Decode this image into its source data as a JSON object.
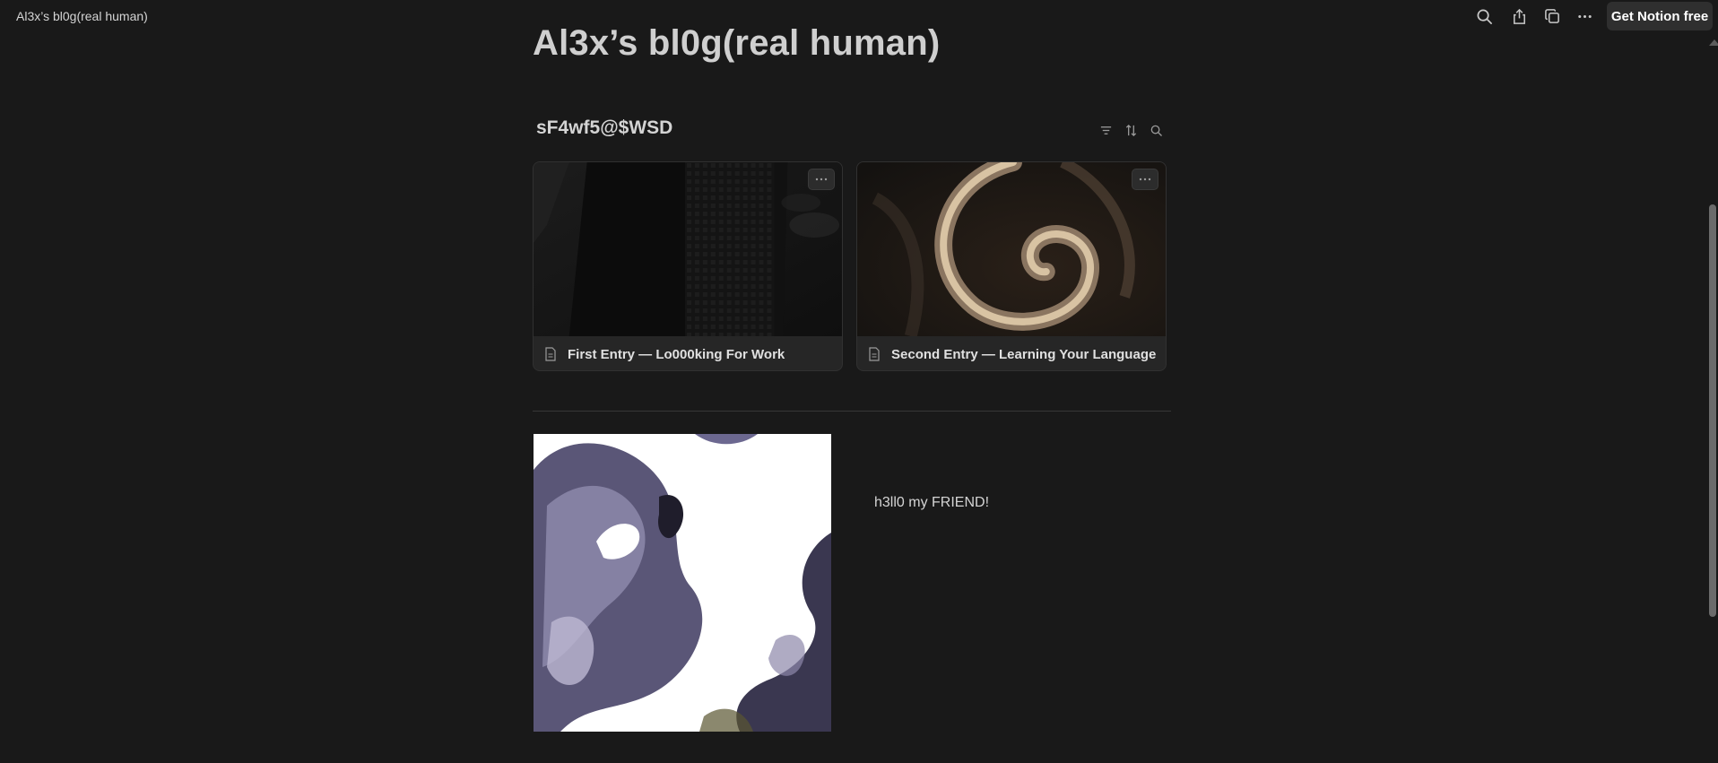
{
  "topbar": {
    "breadcrumb": "Al3x’s bl0g(real human)",
    "icons": [
      "search-icon",
      "share-icon",
      "duplicate-icon",
      "more-icon"
    ],
    "cta_label": "Get Notion free"
  },
  "page": {
    "title": "Al3x’s bl0g(real human)"
  },
  "database": {
    "title": "sF4wf5@$WSD",
    "tools": [
      "filter-icon",
      "sort-icon",
      "search-icon"
    ],
    "cards": [
      {
        "label": "First Entry — Lo000king For Work",
        "icon": "page-icon",
        "cover": "dark building photo"
      },
      {
        "label": "Second Entry — Learning Your Language",
        "icon": "page-icon",
        "cover": "brown spiral swirl"
      }
    ]
  },
  "content": {
    "greeting": "h3ll0 my FRIEND!"
  },
  "colors": {
    "background": "#191919",
    "text": "#d4d4d4",
    "card": "#262626",
    "button": "#2f2f2f",
    "art_purple": "#5a5677"
  }
}
